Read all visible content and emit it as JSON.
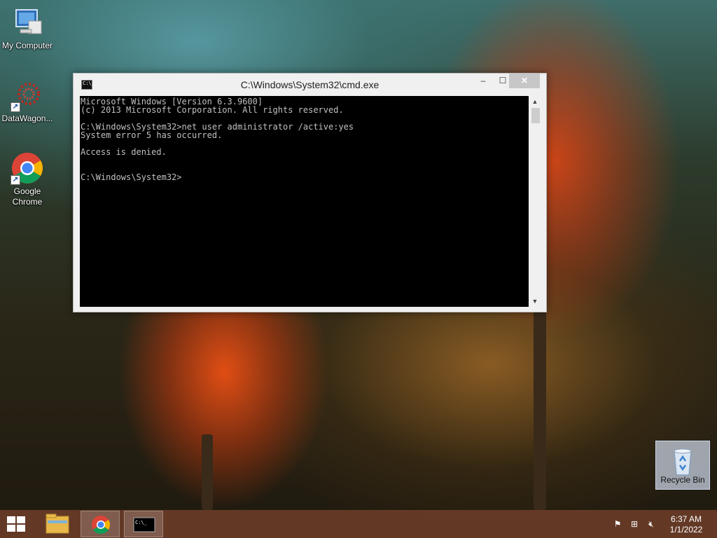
{
  "desktop": {
    "icons": [
      {
        "label": "My Computer",
        "icon": "computer-icon"
      },
      {
        "label": "DataWagon...",
        "icon": "datawagon-icon"
      },
      {
        "label": "Google Chrome",
        "icon": "chrome-icon"
      }
    ],
    "recycle_bin": {
      "label": "Recycle Bin",
      "icon": "recycle-bin-icon"
    }
  },
  "cmd": {
    "title": "C:\\Windows\\System32\\cmd.exe",
    "output": "Microsoft Windows [Version 6.3.9600]\n(c) 2013 Microsoft Corporation. All rights reserved.\n\nC:\\Windows\\System32>net user administrator /active:yes\nSystem error 5 has occurred.\n\nAccess is denied.\n\n\nC:\\Windows\\System32>",
    "buttons": {
      "minimize": "‒",
      "maximize": "☐",
      "close": "✕"
    }
  },
  "taskbar": {
    "items": [
      {
        "name": "file-explorer",
        "icon": "folder-icon"
      },
      {
        "name": "google-chrome",
        "icon": "chrome-icon"
      },
      {
        "name": "command-prompt",
        "icon": "cmd-icon"
      }
    ],
    "tray": [
      "flag-icon",
      "network-icon",
      "volume-muted-icon"
    ],
    "clock": {
      "time": "6:37 AM",
      "date": "1/1/2022"
    }
  },
  "colors": {
    "console_bg": "#000000",
    "console_text": "#c0c0c0",
    "taskbar": "#693c28"
  }
}
